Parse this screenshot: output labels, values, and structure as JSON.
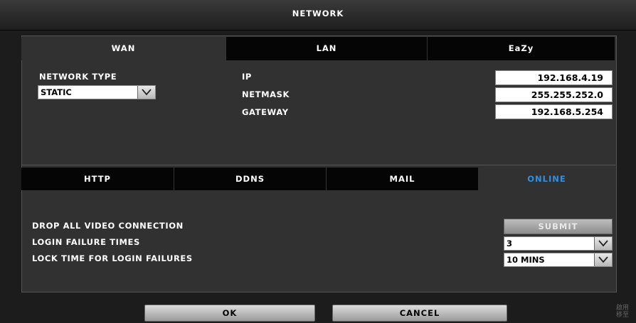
{
  "window": {
    "title": "NETWORK"
  },
  "main_tabs": [
    {
      "label": "WAN",
      "active": true
    },
    {
      "label": "LAN",
      "active": false
    },
    {
      "label": "EaZy",
      "active": false
    }
  ],
  "wan": {
    "network_type_label": "NETWORK TYPE",
    "network_type_value": "STATIC",
    "ip_label": "IP",
    "ip_value": "192.168.4.19",
    "netmask_label": "NETMASK",
    "netmask_value": "255.255.252.0",
    "gateway_label": "GATEWAY",
    "gateway_value": "192.168.5.254"
  },
  "sub_tabs": [
    {
      "label": "HTTP",
      "active": false
    },
    {
      "label": "DDNS",
      "active": false
    },
    {
      "label": "MAIL",
      "active": false
    },
    {
      "label": "ONLINE",
      "active": true
    }
  ],
  "online": {
    "drop_label": "DROP ALL VIDEO CONNECTION",
    "submit_label": "SUBMIT",
    "login_failure_label": "LOGIN FAILURE TIMES",
    "login_failure_value": "3",
    "lock_time_label": "LOCK TIME FOR LOGIN FAILURES",
    "lock_time_value": "10 MINS"
  },
  "footer": {
    "ok_label": "OK",
    "cancel_label": "CANCEL",
    "watermark_line1": "啟用",
    "watermark_line2": "移至"
  },
  "colors": {
    "active_subtab_text": "#2a92e6",
    "panel_bg": "#313131",
    "tab_bg": "#050505"
  },
  "icons": {
    "dropdown": "chevron-down-icon"
  }
}
